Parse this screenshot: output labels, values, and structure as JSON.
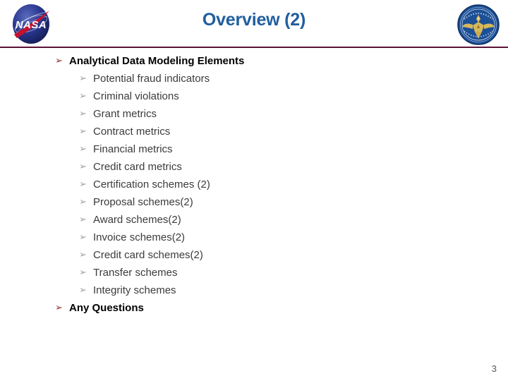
{
  "header": {
    "title": "Overview (2)",
    "left_logo_name": "nasa-meatball-logo",
    "right_logo_name": "oig-seal-logo",
    "rule_color": "#5C1236",
    "title_color": "#215E9E"
  },
  "colors": {
    "title_blue": "#215E9E",
    "rule_maroon": "#5C1236",
    "marker_level1": "#8C2A22",
    "marker_level2": "#9AA3AD",
    "body_text": "#3B3B3B",
    "heading_text": "#000000"
  },
  "bullets": {
    "marker_glyph": "➢",
    "items": [
      {
        "level": 1,
        "text": "Analytical Data Modeling Elements"
      },
      {
        "level": 2,
        "text": "Potential fraud indicators"
      },
      {
        "level": 2,
        "text": "Criminal violations"
      },
      {
        "level": 2,
        "text": "Grant metrics"
      },
      {
        "level": 2,
        "text": "Contract metrics"
      },
      {
        "level": 2,
        "text": "Financial metrics"
      },
      {
        "level": 2,
        "text": "Credit card metrics"
      },
      {
        "level": 2,
        "text": "Certification schemes (2)"
      },
      {
        "level": 2,
        "text": "Proposal schemes(2)"
      },
      {
        "level": 2,
        "text": "Award schemes(2)"
      },
      {
        "level": 2,
        "text": "Invoice schemes(2)"
      },
      {
        "level": 2,
        "text": "Credit card schemes(2)"
      },
      {
        "level": 2,
        "text": "Transfer schemes"
      },
      {
        "level": 2,
        "text": "Integrity schemes"
      },
      {
        "level": 1,
        "text": "Any Questions"
      }
    ]
  },
  "footer": {
    "page_number": "3"
  },
  "bullet_text": {
    "b0": "Analytical Data Modeling Elements",
    "b1": "Potential fraud indicators",
    "b2": "Criminal violations",
    "b3": "Grant metrics",
    "b4": "Contract metrics",
    "b5": "Financial metrics",
    "b6": "Credit card metrics",
    "b7": "Certification schemes (2)",
    "b8": "Proposal schemes(2)",
    "b9": "Award schemes(2)",
    "b10": "Invoice schemes(2)",
    "b11": "Credit card schemes(2)",
    "b12": "Transfer schemes",
    "b13": "Integrity schemes",
    "b14": "Any Questions"
  },
  "markers": {
    "m": "➢"
  }
}
